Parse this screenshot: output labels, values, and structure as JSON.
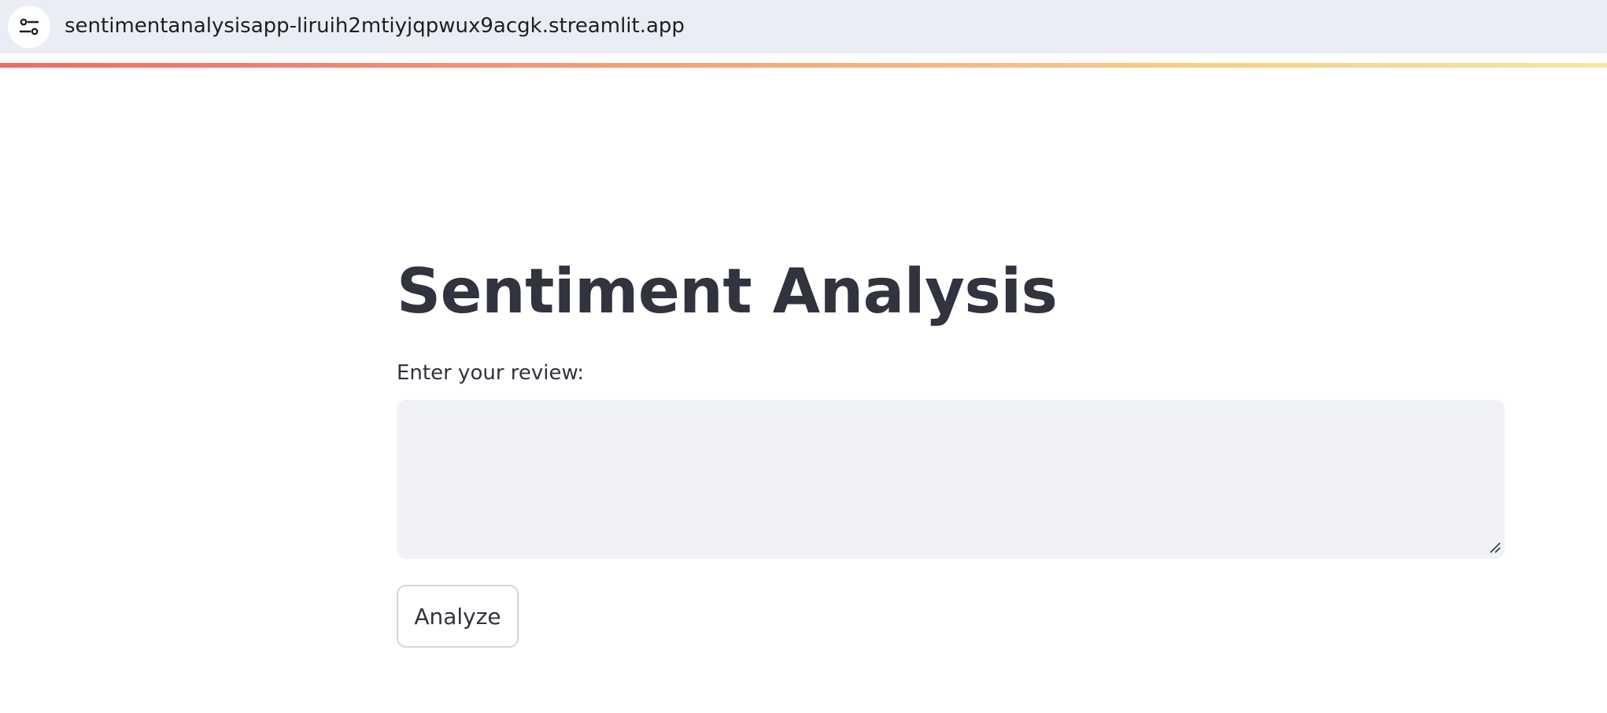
{
  "browser": {
    "url": "sentimentanalysisapp-liruih2mtiyjqpwux9acgk.streamlit.app",
    "site_info_icon": "tune-sliders-icon"
  },
  "app": {
    "title": "Sentiment Analysis",
    "review_field": {
      "label": "Enter your review:",
      "value": "",
      "placeholder": ""
    },
    "analyze_button_label": "Analyze"
  },
  "colors": {
    "text": "#31333f",
    "address_bar_bg": "#eaedf6",
    "input_bg": "#f0f2f6",
    "button_border": "#d5d6da",
    "header_gradient": [
      "#ee6d5f",
      "#f6cf88",
      "#f8e6a0"
    ]
  }
}
